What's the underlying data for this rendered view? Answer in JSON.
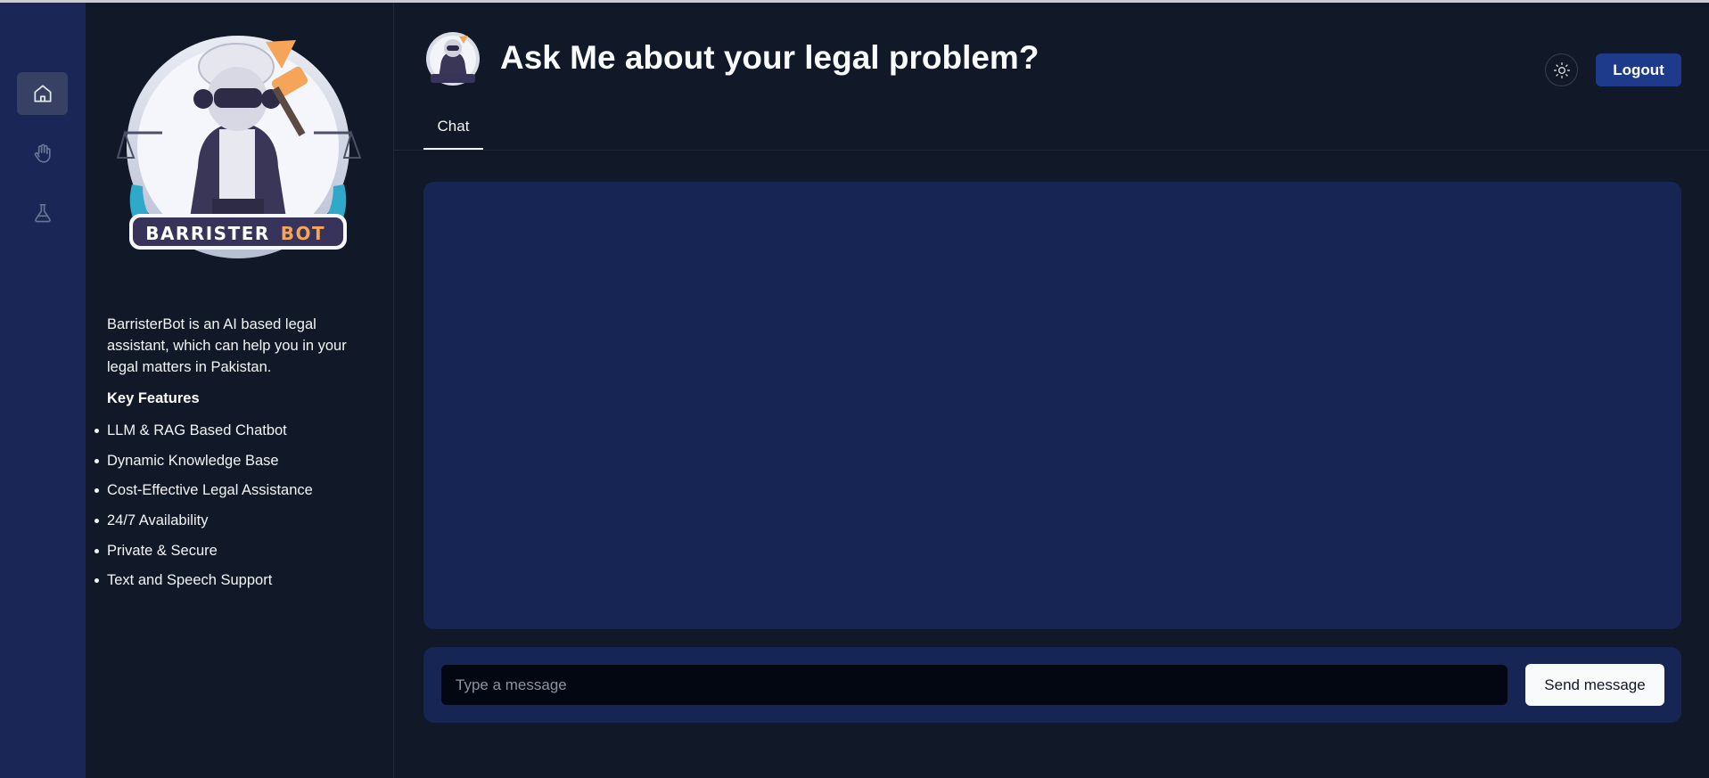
{
  "app": {
    "title": "Ask Me about your legal problem?",
    "brand_left": "BARRISTER",
    "brand_right": "BOT"
  },
  "rail": {
    "items": [
      {
        "name": "home",
        "icon": "home-icon",
        "active": true
      },
      {
        "name": "hand",
        "icon": "hand-icon",
        "active": false
      },
      {
        "name": "lab",
        "icon": "flask-icon",
        "active": false
      }
    ]
  },
  "sidebar": {
    "about": "BarristerBot is an AI based legal assistant, which can help you in your legal matters in Pakistan.",
    "features_title": "Key Features",
    "features": [
      "LLM & RAG Based Chatbot",
      "Dynamic Knowledge Base",
      "Cost-Effective Legal Assistance",
      "24/7 Availability",
      "Private & Secure",
      "Text and Speech Support"
    ]
  },
  "header": {
    "theme_toggle_icon": "sun-icon",
    "logout_label": "Logout"
  },
  "tabs": [
    {
      "label": "Chat",
      "active": true
    }
  ],
  "composer": {
    "placeholder": "Type a message",
    "value": "",
    "send_label": "Send message"
  },
  "colors": {
    "background": "#111827",
    "rail": "#1a2656",
    "panel": "#172554",
    "accent": "#1e3a8a",
    "brand_orange": "#f4a55a"
  }
}
